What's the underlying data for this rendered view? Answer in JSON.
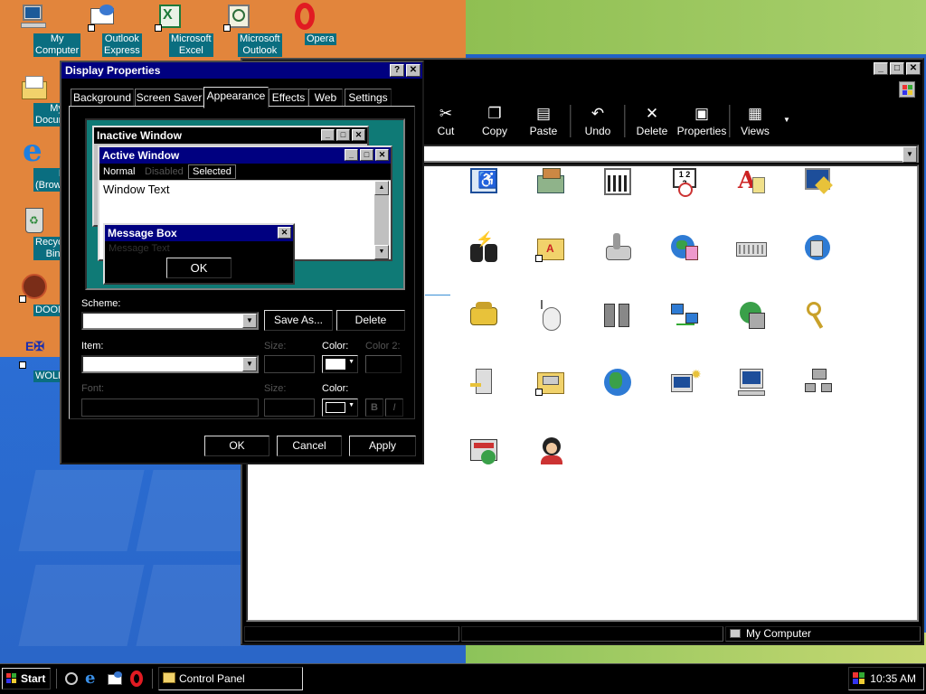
{
  "desktop": {
    "icons": [
      {
        "label": "My Computer",
        "icon": "my-computer-icon"
      },
      {
        "label": "Outlook Express",
        "icon": "outlook-express-icon"
      },
      {
        "label": "Microsoft Excel",
        "icon": "excel-icon"
      },
      {
        "label": "Microsoft Outlook",
        "icon": "outlook-icon"
      },
      {
        "label": "Opera",
        "icon": "opera-icon"
      },
      {
        "label": "My Documen",
        "icon": "folder-icon"
      },
      {
        "label": "IE (Browservice",
        "icon": "internet-explorer-icon"
      },
      {
        "label": "Recycle Bin",
        "icon": "recycle-bin-icon"
      },
      {
        "label": "DOOM",
        "icon": "doom-icon"
      },
      {
        "label": "WOLF3D",
        "icon": "wolf3d-icon"
      }
    ]
  },
  "control_panel": {
    "toolbar": [
      {
        "label": "Cut",
        "icon": "scissors-icon"
      },
      {
        "label": "Copy",
        "icon": "copy-icon"
      },
      {
        "label": "Paste",
        "icon": "paste-icon"
      },
      {
        "label": "Undo",
        "icon": "undo-icon"
      },
      {
        "label": "Delete",
        "icon": "delete-icon"
      },
      {
        "label": "Properties",
        "icon": "properties-icon"
      },
      {
        "label": "Views",
        "icon": "views-icon"
      }
    ],
    "status_location": "My Computer"
  },
  "display_properties": {
    "title": "Display Properties",
    "help_glyph": "?",
    "close_glyph": "✕",
    "tabs": [
      "Background",
      "Screen Saver",
      "Appearance",
      "Effects",
      "Web",
      "Settings"
    ],
    "active_tab": "Appearance",
    "preview": {
      "inactive_title": "Inactive Window",
      "active_title": "Active Window",
      "menu_normal": "Normal",
      "menu_disabled": "Disabled",
      "menu_selected": "Selected",
      "window_text": "Window Text",
      "message_box_title": "Message Box",
      "message_text": "Message Text",
      "ok": "OK"
    },
    "scheme_label": "Scheme:",
    "save_as": "Save As...",
    "delete": "Delete",
    "item_label": "Item:",
    "size_label": "Size:",
    "color_label": "Color:",
    "color2_label": "Color 2:",
    "font_label": "Font:",
    "bold_glyph": "B",
    "italic_glyph": "I",
    "ok": "OK",
    "cancel": "Cancel",
    "apply": "Apply"
  },
  "taskbar": {
    "start": "Start",
    "task": "Control Panel",
    "clock": "10:35 AM"
  }
}
